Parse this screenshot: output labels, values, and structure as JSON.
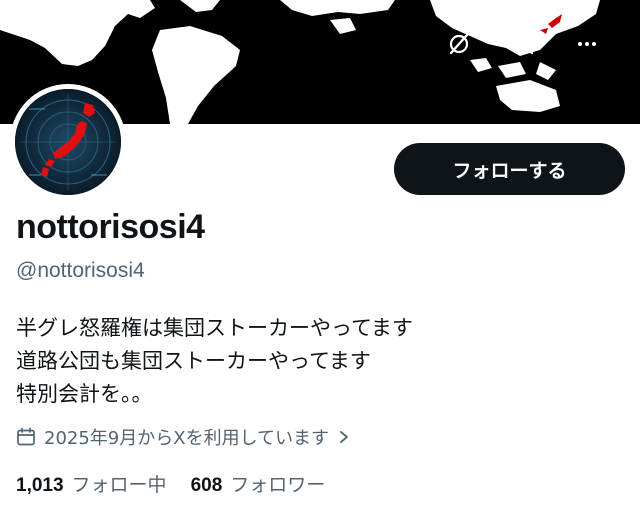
{
  "header": {
    "icons": {
      "back": "arrow-left-icon",
      "grok": "grok-icon",
      "search": "search-icon",
      "more": "more-horizontal-icon"
    },
    "colors": {
      "banner_bg": "#000000",
      "land": "#ffffff",
      "japan_highlight": "#d10000"
    }
  },
  "profile": {
    "avatar_icon": "japan-map-radar-avatar",
    "follow_button_label": "フォローする",
    "display_name": "nottorisosi4",
    "handle": "@nottorisosi4",
    "bio": [
      "半グレ怒羅権は集団ストーカーやってます",
      "道路公団も集団ストーカーやってます",
      "特別会計を。。"
    ],
    "joined_text": "2025年9月からXを利用しています",
    "following_count": "1,013",
    "following_label": "フォロー中",
    "followers_count": "608",
    "followers_label": "フォロワー"
  },
  "colors": {
    "text_primary": "#0f1419",
    "text_secondary": "#536471",
    "button_bg": "#0f1419",
    "button_text": "#ffffff"
  }
}
